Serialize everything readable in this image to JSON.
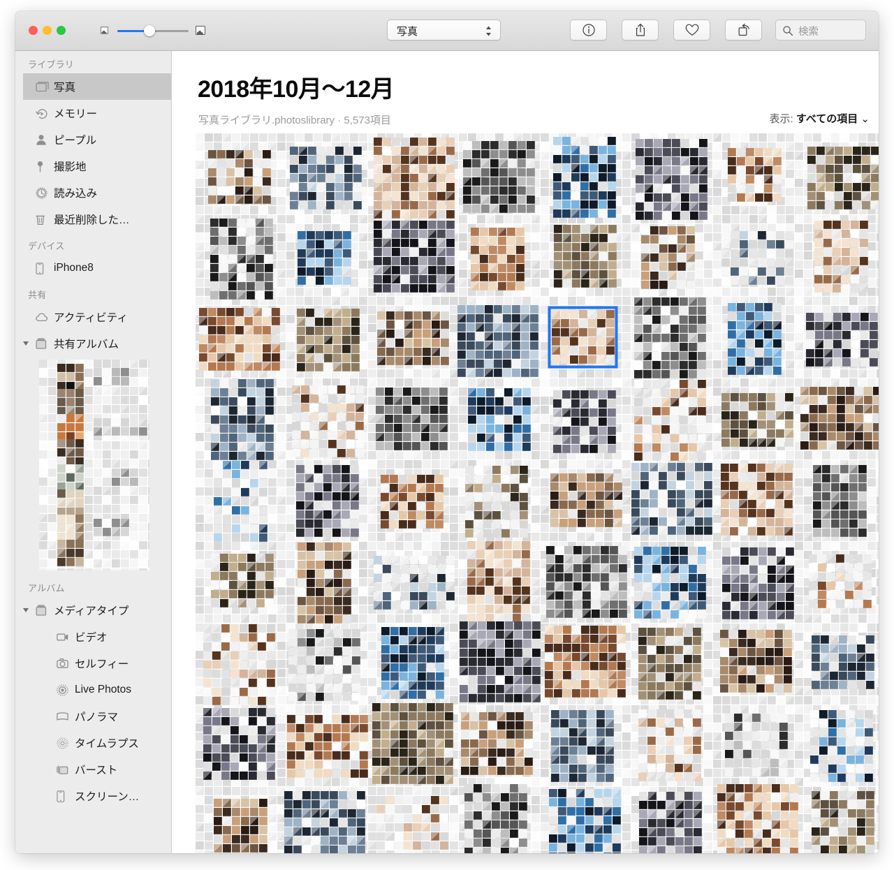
{
  "window": {
    "traffic_lights": [
      {
        "name": "close",
        "color": "#ff5f57"
      },
      {
        "name": "minimize",
        "color": "#febc2e"
      },
      {
        "name": "maximize",
        "color": "#28c840"
      }
    ]
  },
  "toolbar": {
    "zoom_slider": {
      "name": "thumbnail-size-slider",
      "min_icon": "small-thumbnail-icon",
      "max_icon": "large-thumbnail-icon",
      "value_percent": 44,
      "fill_color": "#2176f4"
    },
    "view_popup": {
      "label": "写真",
      "icon": "chevron-updown-icon"
    },
    "buttons": [
      {
        "name": "info-button",
        "icon": "info-icon",
        "label": "情報"
      },
      {
        "name": "share-button",
        "icon": "share-icon",
        "label": "共有"
      },
      {
        "name": "favorite-button",
        "icon": "heart-icon",
        "label": "お気に入り"
      },
      {
        "name": "rotate-button",
        "icon": "rotate-icon",
        "label": "回転"
      }
    ],
    "search": {
      "icon": "search-icon",
      "placeholder": "検索",
      "value": ""
    }
  },
  "sidebar": {
    "sections": [
      {
        "header": "ライブラリ",
        "items": [
          {
            "label": "写真",
            "icon": "photos-stack-icon",
            "selected": true
          },
          {
            "label": "メモリー",
            "icon": "memories-icon",
            "selected": false
          },
          {
            "label": "ピープル",
            "icon": "person-icon",
            "selected": false
          },
          {
            "label": "撮影地",
            "icon": "map-pin-icon",
            "selected": false
          },
          {
            "label": "読み込み",
            "icon": "clock-icon",
            "selected": false
          },
          {
            "label": "最近削除した…",
            "icon": "trash-icon",
            "selected": false
          }
        ]
      },
      {
        "header": "デバイス",
        "items": [
          {
            "label": "iPhone8",
            "icon": "iphone-icon",
            "selected": false
          }
        ]
      },
      {
        "header": "共有",
        "items": [
          {
            "label": "アクティビティ",
            "icon": "cloud-icon",
            "selected": false,
            "disclosure": false
          },
          {
            "label": "共有アルバム",
            "icon": "album-icon",
            "selected": false,
            "disclosure": true
          }
        ]
      },
      {
        "header": "アルバム",
        "items": [
          {
            "label": "メディアタイプ",
            "icon": "album-icon",
            "selected": false,
            "disclosure": true,
            "indent": 1
          },
          {
            "label": "ビデオ",
            "icon": "video-icon",
            "selected": false,
            "indent": 2
          },
          {
            "label": "セルフィー",
            "icon": "camera-icon",
            "selected": false,
            "indent": 2
          },
          {
            "label": "Live Photos",
            "icon": "live-photos-icon",
            "selected": false,
            "indent": 2
          },
          {
            "label": "パノラマ",
            "icon": "panorama-icon",
            "selected": false,
            "indent": 2
          },
          {
            "label": "タイムラプス",
            "icon": "timelapse-icon",
            "selected": false,
            "indent": 2
          },
          {
            "label": "バースト",
            "icon": "burst-icon",
            "selected": false,
            "indent": 2
          },
          {
            "label": "スクリーン…",
            "icon": "iphone-icon",
            "selected": false,
            "indent": 2
          }
        ]
      }
    ]
  },
  "main": {
    "title": "2018年10月〜12月",
    "subtitle": "写真ライブラリ.photoslibrary · 5,573項目",
    "display_filter_label": "表示:",
    "display_filter_value": "すべての項目",
    "display_filter_icon": "chevron-down-icon",
    "grid": {
      "columns": 8,
      "rows": 9,
      "selected_index": 20,
      "selection_color": "#2176f4",
      "thumbnail_size": 116,
      "gap": 7
    }
  }
}
